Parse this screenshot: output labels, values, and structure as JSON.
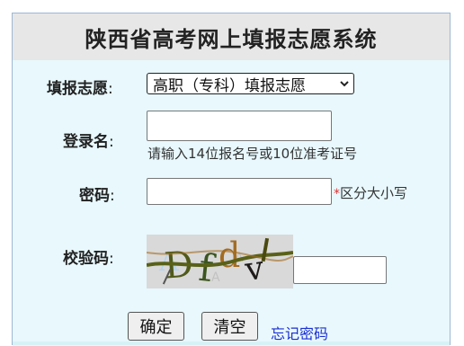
{
  "header": {
    "title": "陕西省高考网上填报志愿系统"
  },
  "form": {
    "type_label": "填报志愿",
    "type_selected": "高职（专科）填报志愿",
    "username_label": "登录名",
    "username_value": "",
    "username_hint": "请输入14位报名号或10位准考证号",
    "password_label": "密码",
    "password_value": "",
    "password_star": "*",
    "password_hint": "区分大小写",
    "captcha_label": "校验码",
    "captcha_text": "Dfdv",
    "captcha_value": "",
    "colon": ":"
  },
  "actions": {
    "confirm_label": "确定",
    "clear_label": "清空",
    "forgot_label": "忘记密码"
  },
  "icons": {
    "select_arrow": "chevron-down-icon"
  },
  "colors": {
    "link": "#1a2fd0",
    "required_star": "#e03030",
    "panel_bg": "#e8f8fd",
    "header_bg": "#e7e7e7"
  }
}
